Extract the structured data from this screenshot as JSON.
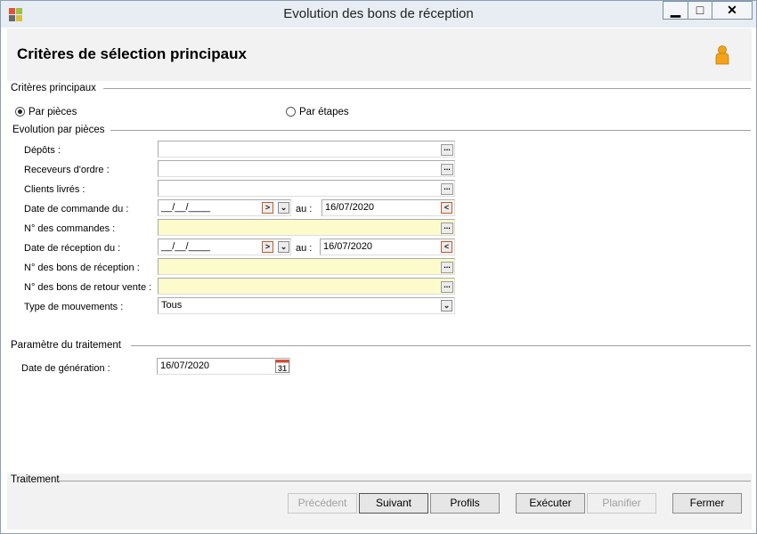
{
  "window": {
    "title": "Evolution des bons de réception",
    "minimize": "▁",
    "maximize": "□",
    "close": "✕"
  },
  "header": {
    "title": "Critères de sélection principaux"
  },
  "sections": {
    "main_criteria": "Critères principaux",
    "evolution": "Evolution par pièces",
    "processing_params": "Paramètre du traitement",
    "processing": "Traitement"
  },
  "radios": {
    "by_parts": "Par pièces",
    "by_steps": "Par étapes",
    "selected": "by_parts"
  },
  "fields": {
    "depots": {
      "label": "Dépôts :",
      "value": ""
    },
    "order_receivers": {
      "label": "Receveurs d'ordre :",
      "value": ""
    },
    "delivered_clients": {
      "label": "Clients livrés :",
      "value": ""
    },
    "order_date": {
      "label": "Date de commande du  :",
      "from": "__/__/____",
      "au": "au :",
      "to": "16/07/2020"
    },
    "order_numbers": {
      "label": "N° des commandes :",
      "value": ""
    },
    "reception_date": {
      "label": "Date de réception du :",
      "from": "__/__/____",
      "au": "au :",
      "to": "16/07/2020"
    },
    "reception_numbers": {
      "label": "N° des bons de réception :",
      "value": ""
    },
    "return_numbers": {
      "label": "N° des bons de retour vente :",
      "value": ""
    },
    "movement_type": {
      "label": "Type de mouvements :",
      "value": "Tous"
    },
    "generation_date": {
      "label": "Date de génération :",
      "value": "16/07/2020"
    }
  },
  "calendar_day": "31",
  "buttons": {
    "previous": "Précédent",
    "next": "Suivant",
    "profiles": "Profils",
    "execute": "Exécuter",
    "schedule": "Planifier",
    "close": "Fermer"
  },
  "colors": {
    "highlight_field": "#fdfbcc",
    "titlebar": "#e8edf3",
    "panel": "#f2f2f2"
  }
}
